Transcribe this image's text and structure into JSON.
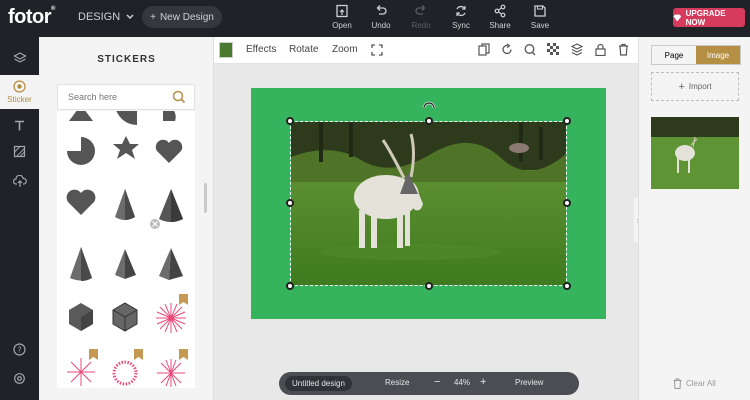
{
  "topbar": {
    "logo": "fotor",
    "design_menu": "DESIGN",
    "new_design": "New Design",
    "tools": [
      {
        "label": "Open",
        "icon": "open-icon"
      },
      {
        "label": "Undo",
        "icon": "undo-icon"
      },
      {
        "label": "Redo",
        "icon": "redo-icon"
      },
      {
        "label": "Sync",
        "icon": "sync-icon"
      },
      {
        "label": "Share",
        "icon": "share-icon"
      },
      {
        "label": "Save",
        "icon": "save-icon"
      }
    ],
    "upgrade": "UPGRADE NOW"
  },
  "rail": {
    "sticker_label": "Sticker"
  },
  "panel": {
    "title": "STICKERS",
    "search_placeholder": "Search here"
  },
  "subtoolbar": {
    "effects": "Effects",
    "rotate": "Rotate",
    "zoom": "Zoom"
  },
  "bottombar": {
    "design_name": "Untitled design",
    "resize": "Resize",
    "zoom_level": "44%",
    "preview": "Preview"
  },
  "rightpanel": {
    "tab_page": "Page",
    "tab_image": "Image",
    "import": "Import",
    "clear_all": "Clear All"
  },
  "colors": {
    "topbar_bg": "#1f2227",
    "accent_gold": "#b58f44",
    "upgrade_red": "#d63a5c",
    "artboard_green": "#36b35d"
  }
}
